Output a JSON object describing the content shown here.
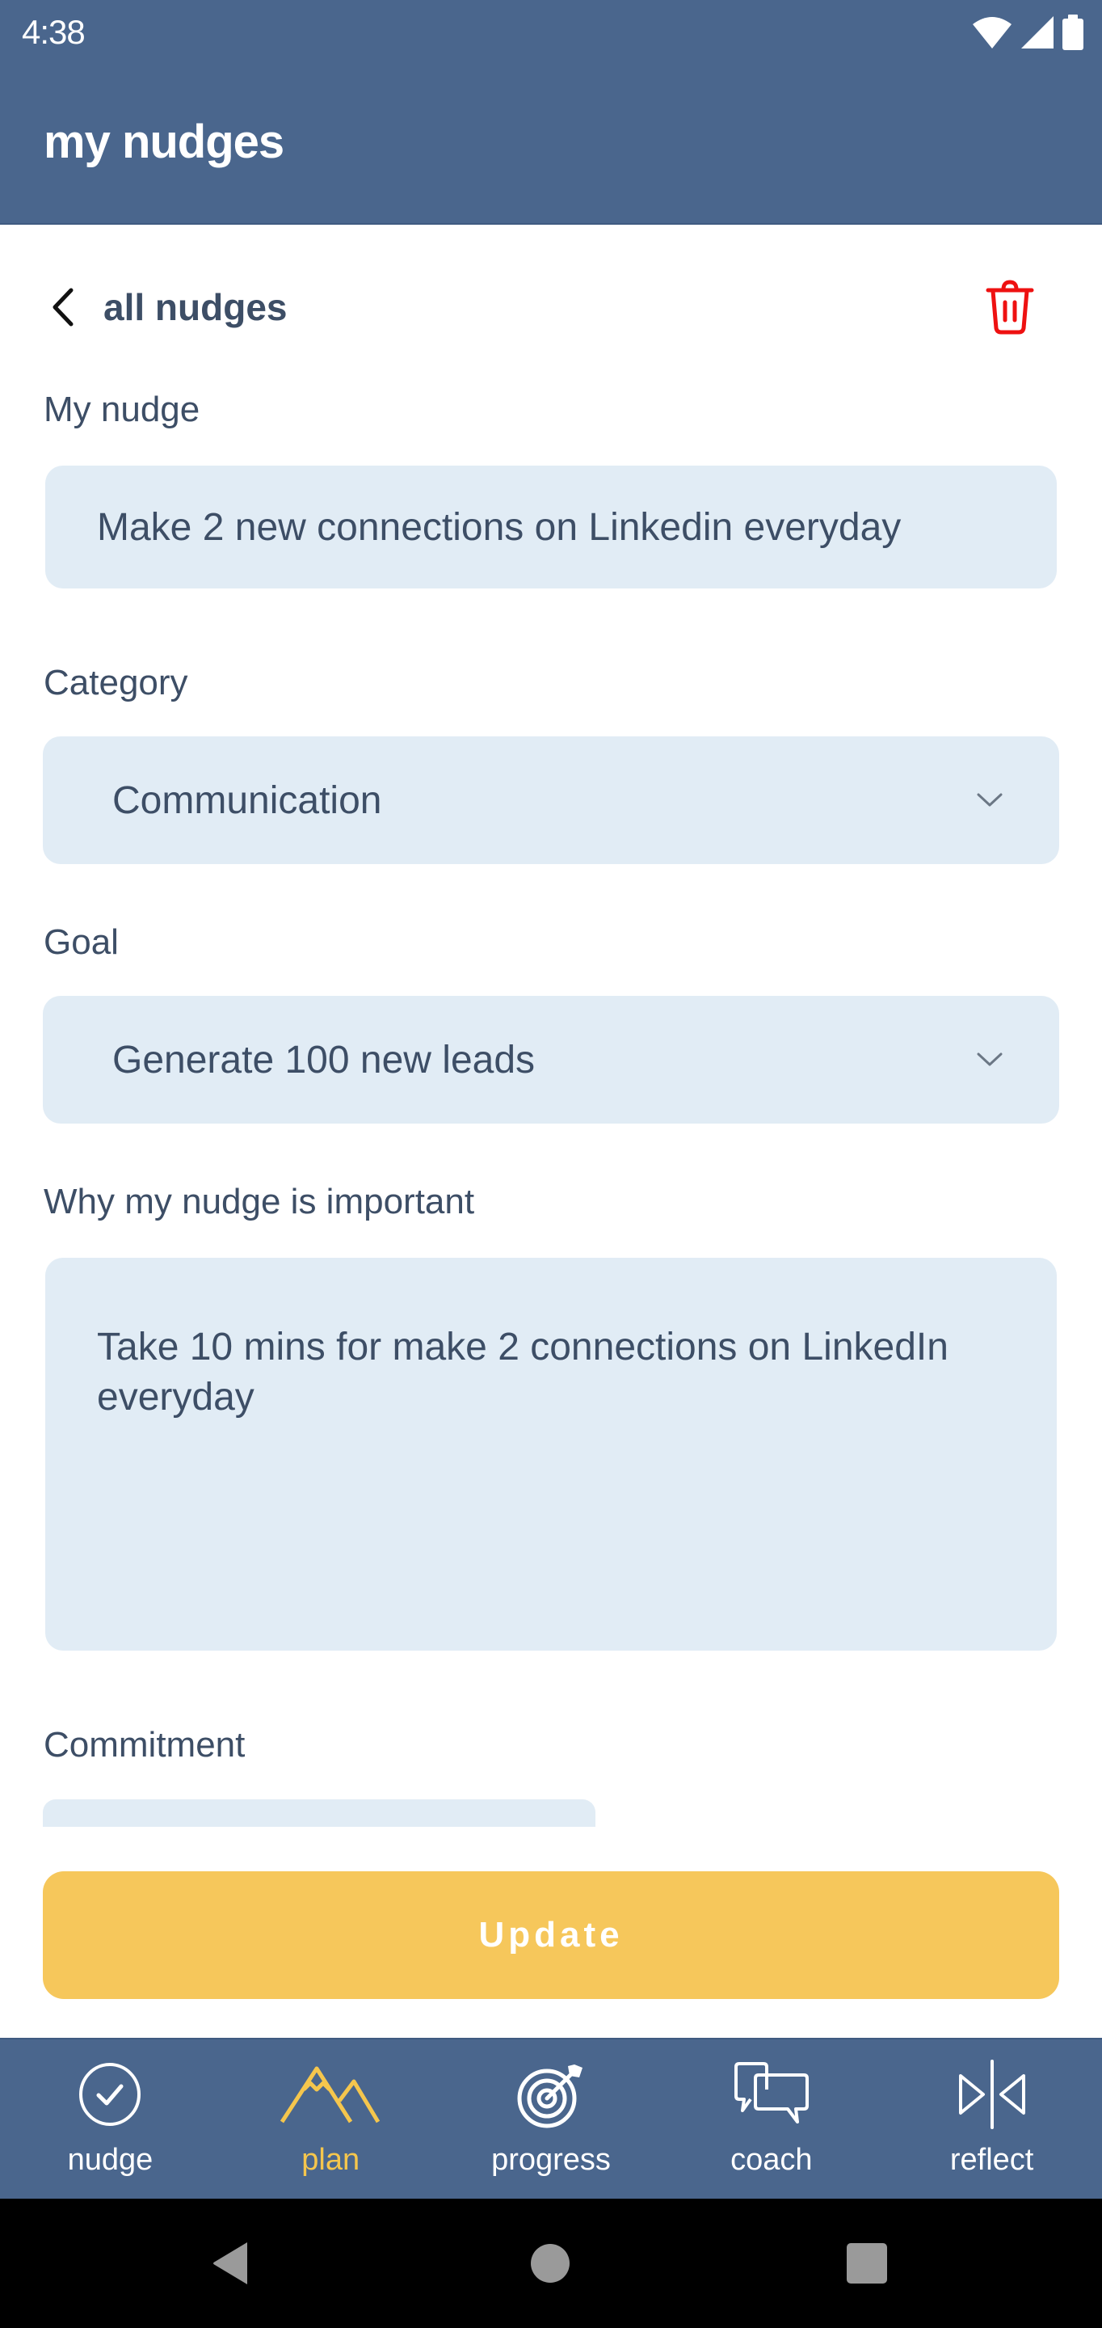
{
  "status_bar": {
    "time": "4:38",
    "icons": [
      "wifi-icon",
      "cellular-signal-icon",
      "battery-icon"
    ]
  },
  "app_bar": {
    "title": "my nudges"
  },
  "header": {
    "back_label": "all nudges",
    "back_icon": "chevron-left-icon",
    "delete_icon": "trash-icon"
  },
  "form": {
    "nudge": {
      "label": "My nudge",
      "value": "Make 2 new connections on Linkedin everyday"
    },
    "category": {
      "label": "Category",
      "selected": "Communication"
    },
    "goal": {
      "label": "Goal",
      "selected": "Generate 100 new leads"
    },
    "importance": {
      "label": "Why my nudge is important",
      "value": "Take 10 mins for make 2 connections on LinkedIn everyday"
    },
    "commitment": {
      "label": "Commitment"
    }
  },
  "actions": {
    "update_label": "Update"
  },
  "bottom_nav": {
    "active": "plan",
    "items": [
      {
        "id": "nudge",
        "label": "nudge",
        "icon": "check-circle-icon"
      },
      {
        "id": "plan",
        "label": "plan",
        "icon": "mountain-icon"
      },
      {
        "id": "progress",
        "label": "progress",
        "icon": "target-icon"
      },
      {
        "id": "coach",
        "label": "coach",
        "icon": "chat-bubbles-icon"
      },
      {
        "id": "reflect",
        "label": "reflect",
        "icon": "reflect-icon"
      }
    ]
  },
  "system_nav": {
    "buttons": [
      "back",
      "home",
      "recents"
    ]
  },
  "colors": {
    "primary": "#4a668d",
    "accent": "#f6c75b",
    "active_nav": "#f5c64d",
    "field_bg": "#e1ecf5",
    "text": "#3d4e66",
    "danger": "#ee1111"
  }
}
